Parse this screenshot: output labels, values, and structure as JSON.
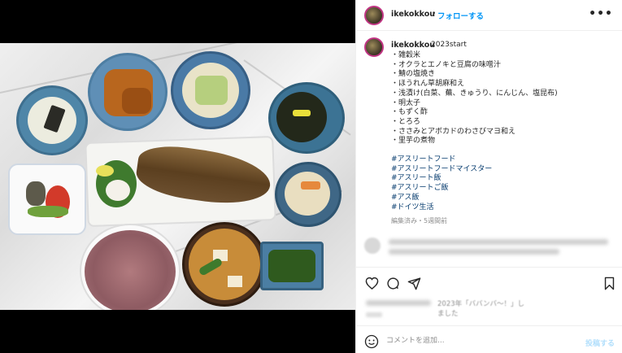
{
  "header": {
    "username": "ikekokkou",
    "separator": "•",
    "follow_label": "フォローする",
    "more_label": "•••"
  },
  "caption": {
    "username": "ikekokkou",
    "title": "2023start",
    "lines": [
      "・雑穀米",
      "・オクラとエノキと豆腐の味噌汁",
      "・鯖の塩焼き",
      "・ほうれん草胡麻和え",
      "・浅漬け(白菜、蕪、きゅうり、にんじん、塩昆布)",
      "・明太子",
      "・もずく酢",
      "・とろろ",
      "・ささみとアボカドのわさびマヨ和え",
      "・里芋の煮物"
    ],
    "hashtags": [
      "#アスリートフード",
      "#アスリートフードマイスター",
      "#アスリート飯",
      "#アスリートご飯",
      "#アス飯",
      "#ドイツ生活"
    ],
    "edited": "編集済み・5週間前"
  },
  "likes_text": "2023年「ババンバ〜！」しました",
  "comment": {
    "placeholder": "コメントを追加...",
    "post_label": "投稿する"
  },
  "icons": {
    "heart": "heart-icon",
    "comment": "comment-icon",
    "share": "share-icon",
    "save": "bookmark-icon",
    "emoji": "emoji-icon"
  },
  "colors": {
    "accent": "#0095f6",
    "hashtag": "#00376b",
    "muted": "#8e8e8e"
  }
}
